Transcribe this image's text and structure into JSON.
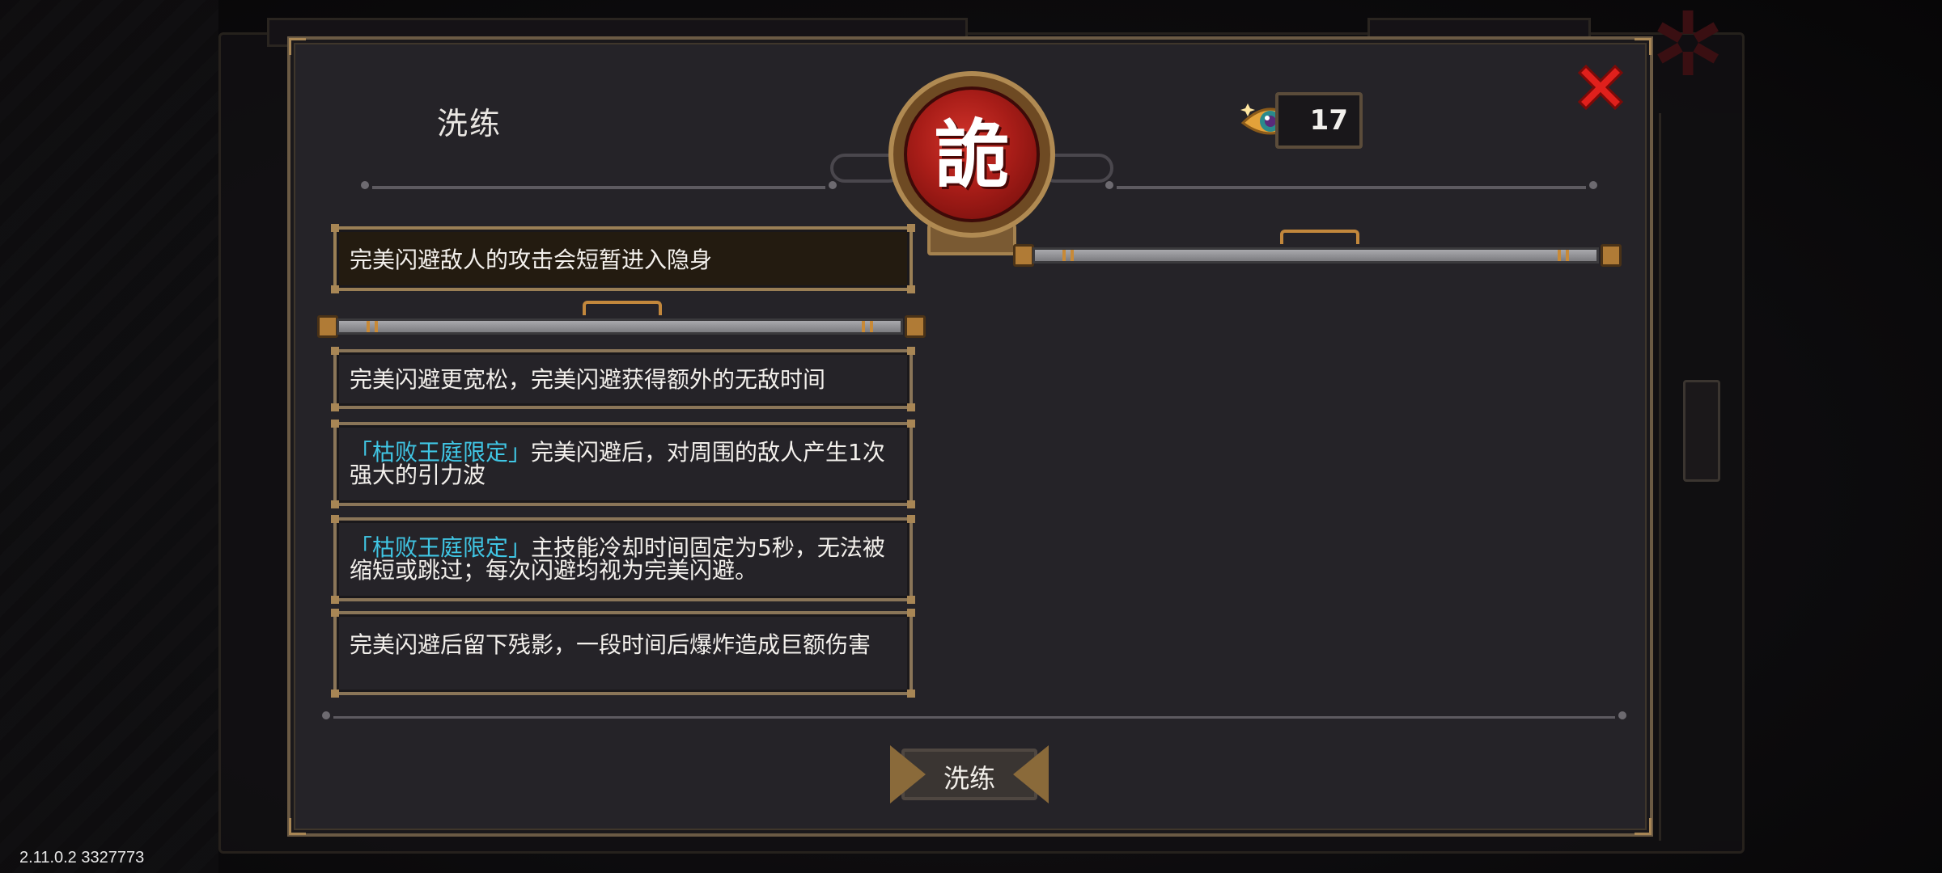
{
  "dialog": {
    "title": "洗练",
    "emblem_char": "詭",
    "currency": {
      "icon": "eye-gem-icon",
      "count": "17"
    },
    "close_icon": "close-x-icon"
  },
  "options": [
    {
      "text": "完美闪避敌人的攻击会短暂进入隐身",
      "selected": true
    },
    {
      "text": "完美闪避更宽松，完美闪避获得额外的无敌时间"
    },
    {
      "tag": "「枯败王庭限定」",
      "text": "完美闪避后，对周围的敌人产生1次强大的引力波"
    },
    {
      "tag": "「枯败王庭限定」",
      "text": "主技能冷却时间固定为5秒，无法被缩短或跳过；每次闪避均视为完美闪避。"
    },
    {
      "text": "完美闪避后留下残影，一段时间后爆炸造成巨额伤害"
    }
  ],
  "refine_button": {
    "label": "洗练"
  },
  "version": "2.11.0.2 3327773",
  "colors": {
    "highlight": "#40c6e4",
    "close": "#e0201c",
    "emblem": "#b8221c"
  }
}
